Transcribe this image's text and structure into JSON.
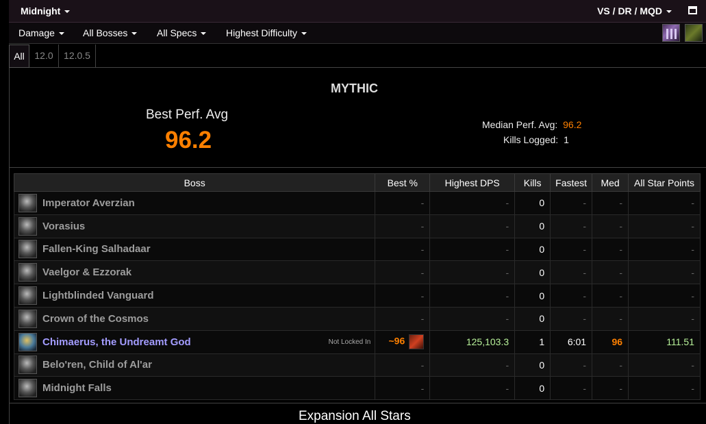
{
  "topbar": {
    "zone": "Midnight",
    "raid": "VS / DR / MQD"
  },
  "filters": {
    "metric": "Damage",
    "bosses": "All Bosses",
    "specs": "All Specs",
    "difficulty": "Highest Difficulty"
  },
  "icons": {
    "spec": "spec-icon",
    "key": "key-icon",
    "maximize": "maximize-icon"
  },
  "tabs": [
    "All",
    "12.0",
    "12.0.5"
  ],
  "summary": {
    "difficulty": "MYTHIC",
    "best_label": "Best Perf. Avg",
    "best_value": "96.2",
    "median_label": "Median Perf. Avg:",
    "median_value": "96.2",
    "kills_label": "Kills Logged:",
    "kills_value": "1"
  },
  "table": {
    "headers": [
      "Boss",
      "Best %",
      "Highest DPS",
      "Kills",
      "Fastest",
      "Med",
      "All Star Points"
    ],
    "rows": [
      {
        "boss": "Imperator Averzian",
        "best": "-",
        "dps": "-",
        "kills": "0",
        "fastest": "-",
        "med": "-",
        "points": "-"
      },
      {
        "boss": "Vorasius",
        "best": "-",
        "dps": "-",
        "kills": "0",
        "fastest": "-",
        "med": "-",
        "points": "-"
      },
      {
        "boss": "Fallen-King Salhadaar",
        "best": "-",
        "dps": "-",
        "kills": "0",
        "fastest": "-",
        "med": "-",
        "points": "-"
      },
      {
        "boss": "Vaelgor & Ezzorak",
        "best": "-",
        "dps": "-",
        "kills": "0",
        "fastest": "-",
        "med": "-",
        "points": "-"
      },
      {
        "boss": "Lightblinded Vanguard",
        "best": "-",
        "dps": "-",
        "kills": "0",
        "fastest": "-",
        "med": "-",
        "points": "-"
      },
      {
        "boss": "Crown of the Cosmos",
        "best": "-",
        "dps": "-",
        "kills": "0",
        "fastest": "-",
        "med": "-",
        "points": "-"
      },
      {
        "boss": "Chimaerus, the Undreamt God",
        "note": "Not Locked In",
        "best": "~96",
        "dps": "125,103.3",
        "kills": "1",
        "fastest": "6:01",
        "med": "96",
        "points": "111.51"
      },
      {
        "boss": "Belo'ren, Child of Al'ar",
        "best": "-",
        "dps": "-",
        "kills": "0",
        "fastest": "-",
        "med": "-",
        "points": "-"
      },
      {
        "boss": "Midnight Falls",
        "best": "-",
        "dps": "-",
        "kills": "0",
        "fastest": "-",
        "med": "-",
        "points": "-"
      }
    ]
  },
  "footer": {
    "title": "Expansion All Stars"
  },
  "colors": {
    "accent": "#ff8000",
    "boss_active": "#a39cff",
    "positive": "#b8f29a"
  }
}
